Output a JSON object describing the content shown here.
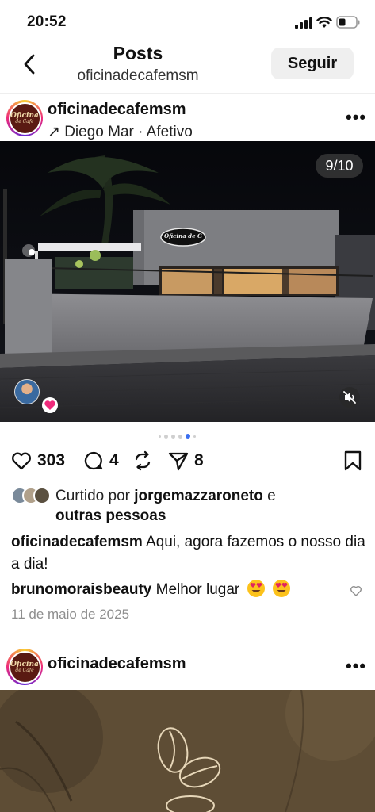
{
  "status_bar": {
    "time": "20:52"
  },
  "nav": {
    "title": "Posts",
    "subtitle": "oficinadecafemsm",
    "follow_label": "Seguir"
  },
  "post": {
    "username": "oficinadecafemsm",
    "avatar_text_line1": "Oficina",
    "avatar_text_line2": "de Café",
    "music_arrow": "↗",
    "music": "Diego Mar · Afetivo",
    "more": "•••",
    "image_counter": "9/10",
    "sign_text": "Oficina de Café",
    "carousel": {
      "total": 6,
      "active_index": 4
    },
    "counts": {
      "likes": "303",
      "comments": "4",
      "reposts": "",
      "shares": "8"
    },
    "liked_by_prefix": "Curtido por",
    "liked_by_user": "jorgemazzaroneto",
    "liked_by_and": "e",
    "liked_by_others": "outras pessoas",
    "caption_user": "oficinadecafemsm",
    "caption_text": "Aqui, agora fazemos o nosso dia a dia!",
    "comment_user": "brunomoraisbeauty",
    "comment_text": "Melhor lugar",
    "date": "11 de maio de 2025"
  },
  "post2": {
    "username": "oficinadecafemsm",
    "avatar_text_line1": "Oficina",
    "avatar_text_line2": "de Café",
    "more": "•••"
  },
  "colors": {
    "accent_blue": "#3b6ff0",
    "heart_pink": "#ee2a7b",
    "muted_text": "#8e8e8e",
    "button_bg": "#efefef"
  }
}
